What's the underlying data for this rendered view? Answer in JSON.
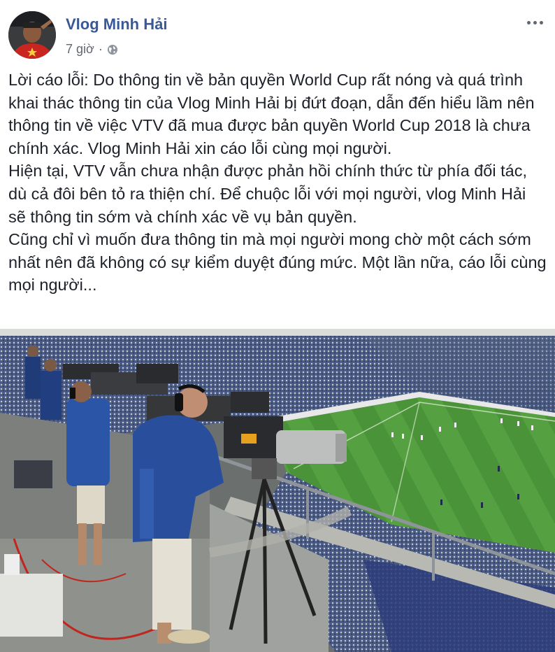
{
  "post": {
    "author": "Vlog Minh Hải",
    "time": "7 giờ",
    "separator": "·",
    "privacy_icon": "globe-icon",
    "more_icon": "more-options-icon",
    "paragraphs": [
      "Lời cáo lỗi: Do thông tin về bản quyền World Cup rất nóng và quá trình khai thác thông tin của Vlog Minh Hải bị đứt đoạn, dẫn đến hiểu lầm nên thông tin về việc VTV đã mua được bản quyền World Cup 2018 là chưa chính xác. Vlog Minh Hải xin cáo lỗi cùng mọi người.",
      "Hiện tại, VTV vẫn chưa nhận được phản hồi chính thức từ phía đối tác, dù cả đôi bên tỏ ra thiện chí. Để chuộc lỗi với mọi người, vlog Minh Hải sẽ thông tin sớm và chính xác về vụ bản quyền.",
      "Cũng chỉ vì muốn đưa thông tin mà mọi người mong chờ một cách sớm nhất nên đã không có sự kiểm duyệt đúng mức. Một lần nữa, cáo lỗi cùng mọi người..."
    ]
  },
  "colors": {
    "author_link": "#385898",
    "meta_text": "#616770",
    "body_text": "#1d2129",
    "pitch_green": "#4f9a3c"
  }
}
